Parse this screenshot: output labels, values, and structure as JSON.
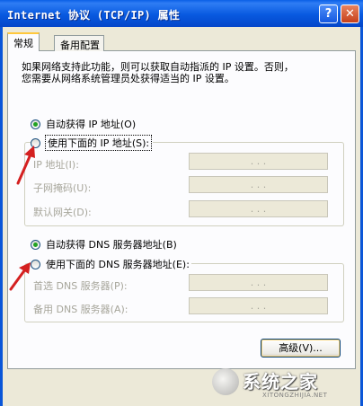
{
  "window": {
    "title": "Internet 协议 (TCP/IP) 属性",
    "help_label": "?",
    "close_label": "✕"
  },
  "tabs": [
    {
      "label": "常规",
      "selected": true
    },
    {
      "label": "备用配置",
      "selected": false
    }
  ],
  "description": [
    "如果网络支持此功能，则可以获取自动指派的 IP 设置。否则，",
    "您需要从网络系统管理员处获得适当的 IP 设置。"
  ],
  "ip_section": {
    "auto_label": "自动获得 IP 地址(O)",
    "manual_label": "使用下面的 IP 地址(S):",
    "selected": "auto",
    "fields": [
      {
        "label": "IP 地址(I):",
        "value": ". . ."
      },
      {
        "label": "子网掩码(U):",
        "value": ". . ."
      },
      {
        "label": "默认网关(D):",
        "value": ". . ."
      }
    ]
  },
  "dns_section": {
    "auto_label": "自动获得 DNS 服务器地址(B)",
    "manual_label": "使用下面的 DNS 服务器地址(E):",
    "selected": "auto",
    "fields": [
      {
        "label": "首选 DNS 服务器(P):",
        "value": ". . ."
      },
      {
        "label": "备用 DNS 服务器(A):",
        "value": ". . ."
      }
    ]
  },
  "advanced_button": "高级(V)...",
  "watermark": {
    "name": "系统之家",
    "url": "XITONGZHIJIA.NET"
  },
  "colors": {
    "titlebar": "#0A5FE6",
    "dialog_bg": "#ECE9D8",
    "radio_dot": "#21A121",
    "annotation_arrow": "#D42020"
  }
}
